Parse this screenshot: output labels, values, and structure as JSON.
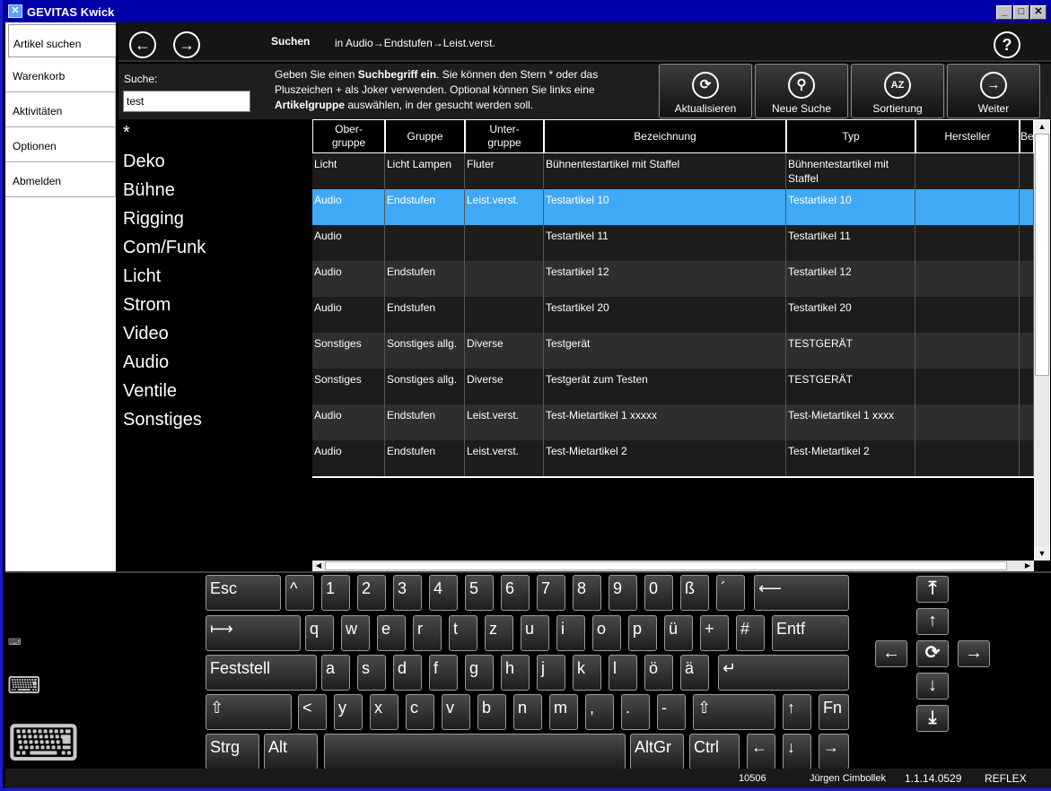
{
  "window": {
    "title": "GEVITAS Kwick"
  },
  "nav": {
    "items": [
      {
        "label": "Artikel suchen"
      },
      {
        "label": "Warenkorb"
      },
      {
        "label": "Aktivitäten"
      },
      {
        "label": "Optionen"
      },
      {
        "label": "Abmelden"
      }
    ]
  },
  "topbar": {
    "title": "Suchen",
    "breadcrumb": "in Audio→Endstufen→Leist.verst.",
    "help": "?"
  },
  "search": {
    "label": "Suche:",
    "value": "test"
  },
  "hint": {
    "p1": "Geben Sie einen ",
    "b1": "Suchbegriff ein",
    "p2": ". Sie können den Stern * oder das Pluszeichen + als Joker verwenden. Optional können Sie links eine ",
    "b2": "Artikelgruppe",
    "p3": " auswählen, in der gesucht werden soll."
  },
  "actions": [
    {
      "label": "Aktualisieren",
      "icon": "refresh-icon"
    },
    {
      "label": "Neue Suche",
      "icon": "search-icon"
    },
    {
      "label": "Sortierung",
      "icon": "sort-az-icon"
    },
    {
      "label": "Weiter",
      "icon": "arrow-right-icon"
    }
  ],
  "groups": [
    "*",
    "Deko",
    "Bühne",
    "Rigging",
    "Com/Funk",
    "Licht",
    "Strom",
    "Video",
    "Audio",
    "Ventile",
    "Sonstiges"
  ],
  "table": {
    "headers": [
      "Ober-\ngruppe",
      "Gruppe",
      "Unter-\ngruppe",
      "Bezeichnung",
      "Typ",
      "Hersteller",
      "Be"
    ],
    "rows": [
      [
        "Licht",
        "Licht Lampen",
        "Fluter",
        "Bühnentestartikel mit Staffel",
        "Bühnentestartikel mit Staffel",
        ""
      ],
      [
        "Audio",
        "Endstufen",
        "Leist.verst.",
        "Testartikel 10",
        "Testartikel 10",
        ""
      ],
      [
        "Audio",
        "",
        "",
        "Testartikel 11",
        "Testartikel 11",
        ""
      ],
      [
        "Audio",
        "Endstufen",
        "",
        "Testartikel 12",
        "Testartikel 12",
        ""
      ],
      [
        "Audio",
        "Endstufen",
        "",
        "Testartikel 20",
        "Testartikel 20",
        ""
      ],
      [
        "Sonstiges",
        "Sonstiges allg.",
        "Diverse",
        "Testgerät",
        "TESTGERÄT",
        ""
      ],
      [
        "Sonstiges",
        "Sonstiges allg.",
        "Diverse",
        "Testgerät zum Testen",
        "TESTGERÄT",
        ""
      ],
      [
        "Audio",
        "Endstufen",
        "Leist.verst.",
        "Test-Mietartikel 1 xxxxx",
        "Test-Mietartikel 1 xxxx",
        ""
      ],
      [
        "Audio",
        "Endstufen",
        "Leist.verst.",
        "Test-Mietartikel 2",
        "Test-Mietartikel 2",
        ""
      ]
    ],
    "selected_row": 1
  },
  "keyboard": {
    "rows": [
      [
        "Esc",
        "^",
        "1",
        "2",
        "3",
        "4",
        "5",
        "6",
        "7",
        "8",
        "9",
        "0",
        "ß",
        "´",
        "⟵"
      ],
      [
        "⟼",
        "q",
        "w",
        "e",
        "r",
        "t",
        "z",
        "u",
        "i",
        "o",
        "p",
        "ü",
        "+",
        "#",
        "Entf"
      ],
      [
        "Feststell",
        "a",
        "s",
        "d",
        "f",
        "g",
        "h",
        "j",
        "k",
        "l",
        "ö",
        "ä",
        "↵"
      ],
      [
        "⇧",
        "<",
        "y",
        "x",
        "c",
        "v",
        "b",
        "n",
        "m",
        ",",
        ".",
        "-",
        "⇧",
        "↑",
        "Fn"
      ],
      [
        "Strg",
        "Alt",
        " ",
        "AltGr",
        "Ctrl",
        "←",
        "↓",
        "→"
      ]
    ],
    "nav_keys": {
      "top": "⤒",
      "up": "↑",
      "left": "←",
      "refresh": "⟳",
      "right": "→",
      "down": "↓",
      "bottom": "⤓"
    }
  },
  "status": {
    "code": "10506",
    "user": "Jürgen Cimbollek",
    "version": "1.1.14.0529",
    "brand": "REFLEX"
  }
}
